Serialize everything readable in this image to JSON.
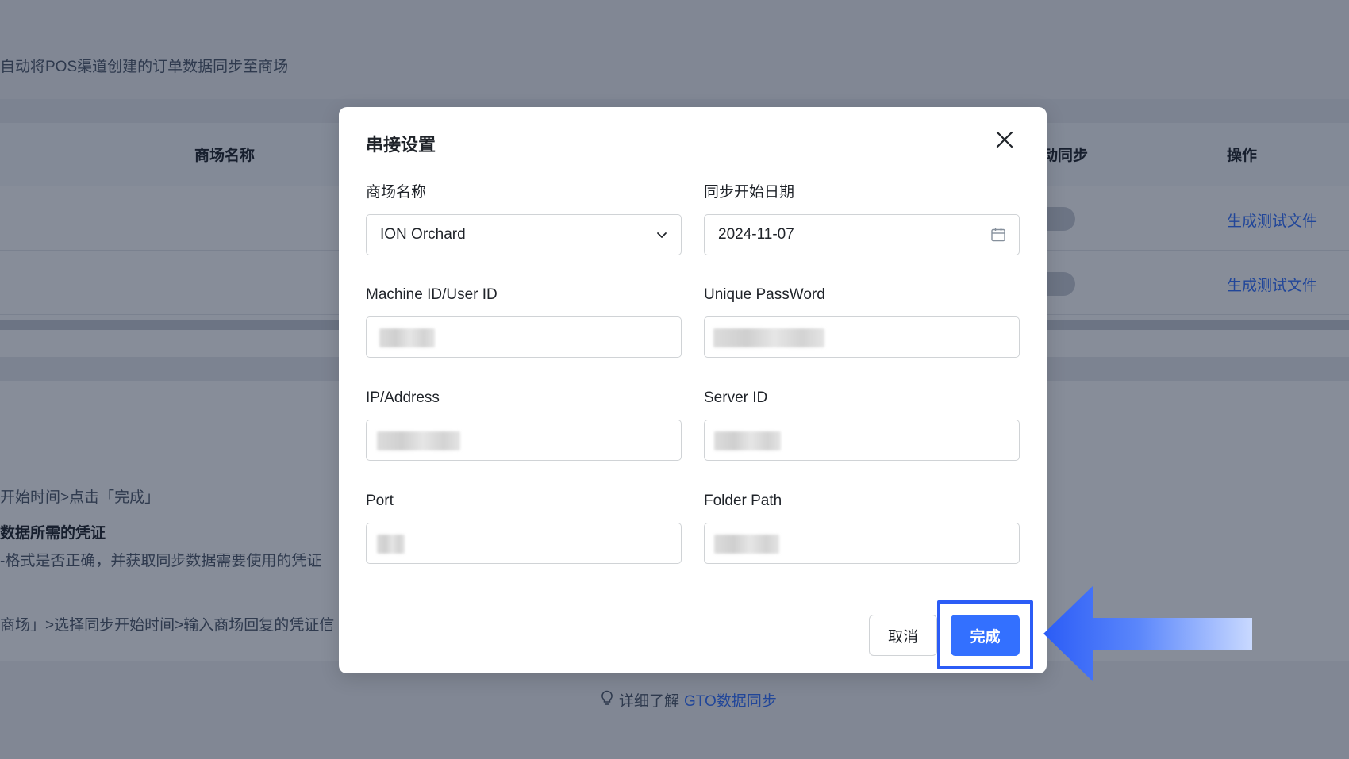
{
  "background": {
    "description": "自动将POS渠道创建的订单数据同步至商场",
    "table": {
      "col_mall_name": "商场名称",
      "col_auto_sync": "动同步",
      "col_actions": "操作",
      "rows": [
        {
          "action": "生成测试文件"
        },
        {
          "action": "生成测试文件"
        }
      ]
    },
    "steps": [
      {
        "text": "开始时间>点击「完成」",
        "bold": false
      },
      {
        "text": "数据所需的凭证",
        "bold": true
      },
      {
        "text": "-格式是否正确，并获取同步数据需要使用的凭证",
        "bold": false
      },
      {
        "text": "商场」>选择同步开始时间>输入商场回复的凭证信",
        "bold": false
      }
    ],
    "learn_more": {
      "icon": "lightbulb-icon",
      "prefix": "详细了解",
      "link": "GTO数据同步"
    }
  },
  "modal": {
    "title": "串接设置",
    "close_icon": "close-icon",
    "fields": {
      "mall_name": {
        "label": "商场名称",
        "value": "ION Orchard",
        "icon": "chevron-down-icon"
      },
      "sync_start_date": {
        "label": "同步开始日期",
        "value": "2024-11-07",
        "icon": "calendar-icon"
      },
      "machine_id": {
        "label": "Machine ID/User ID"
      },
      "unique_password": {
        "label": "Unique PassWord"
      },
      "ip_address": {
        "label": "IP/Address"
      },
      "server_id": {
        "label": "Server ID"
      },
      "port": {
        "label": "Port"
      },
      "folder_path": {
        "label": "Folder Path"
      }
    },
    "buttons": {
      "cancel": "取消",
      "done": "完成"
    }
  },
  "colors": {
    "primary": "#3370ff",
    "annotation": "#2b5cf6"
  }
}
